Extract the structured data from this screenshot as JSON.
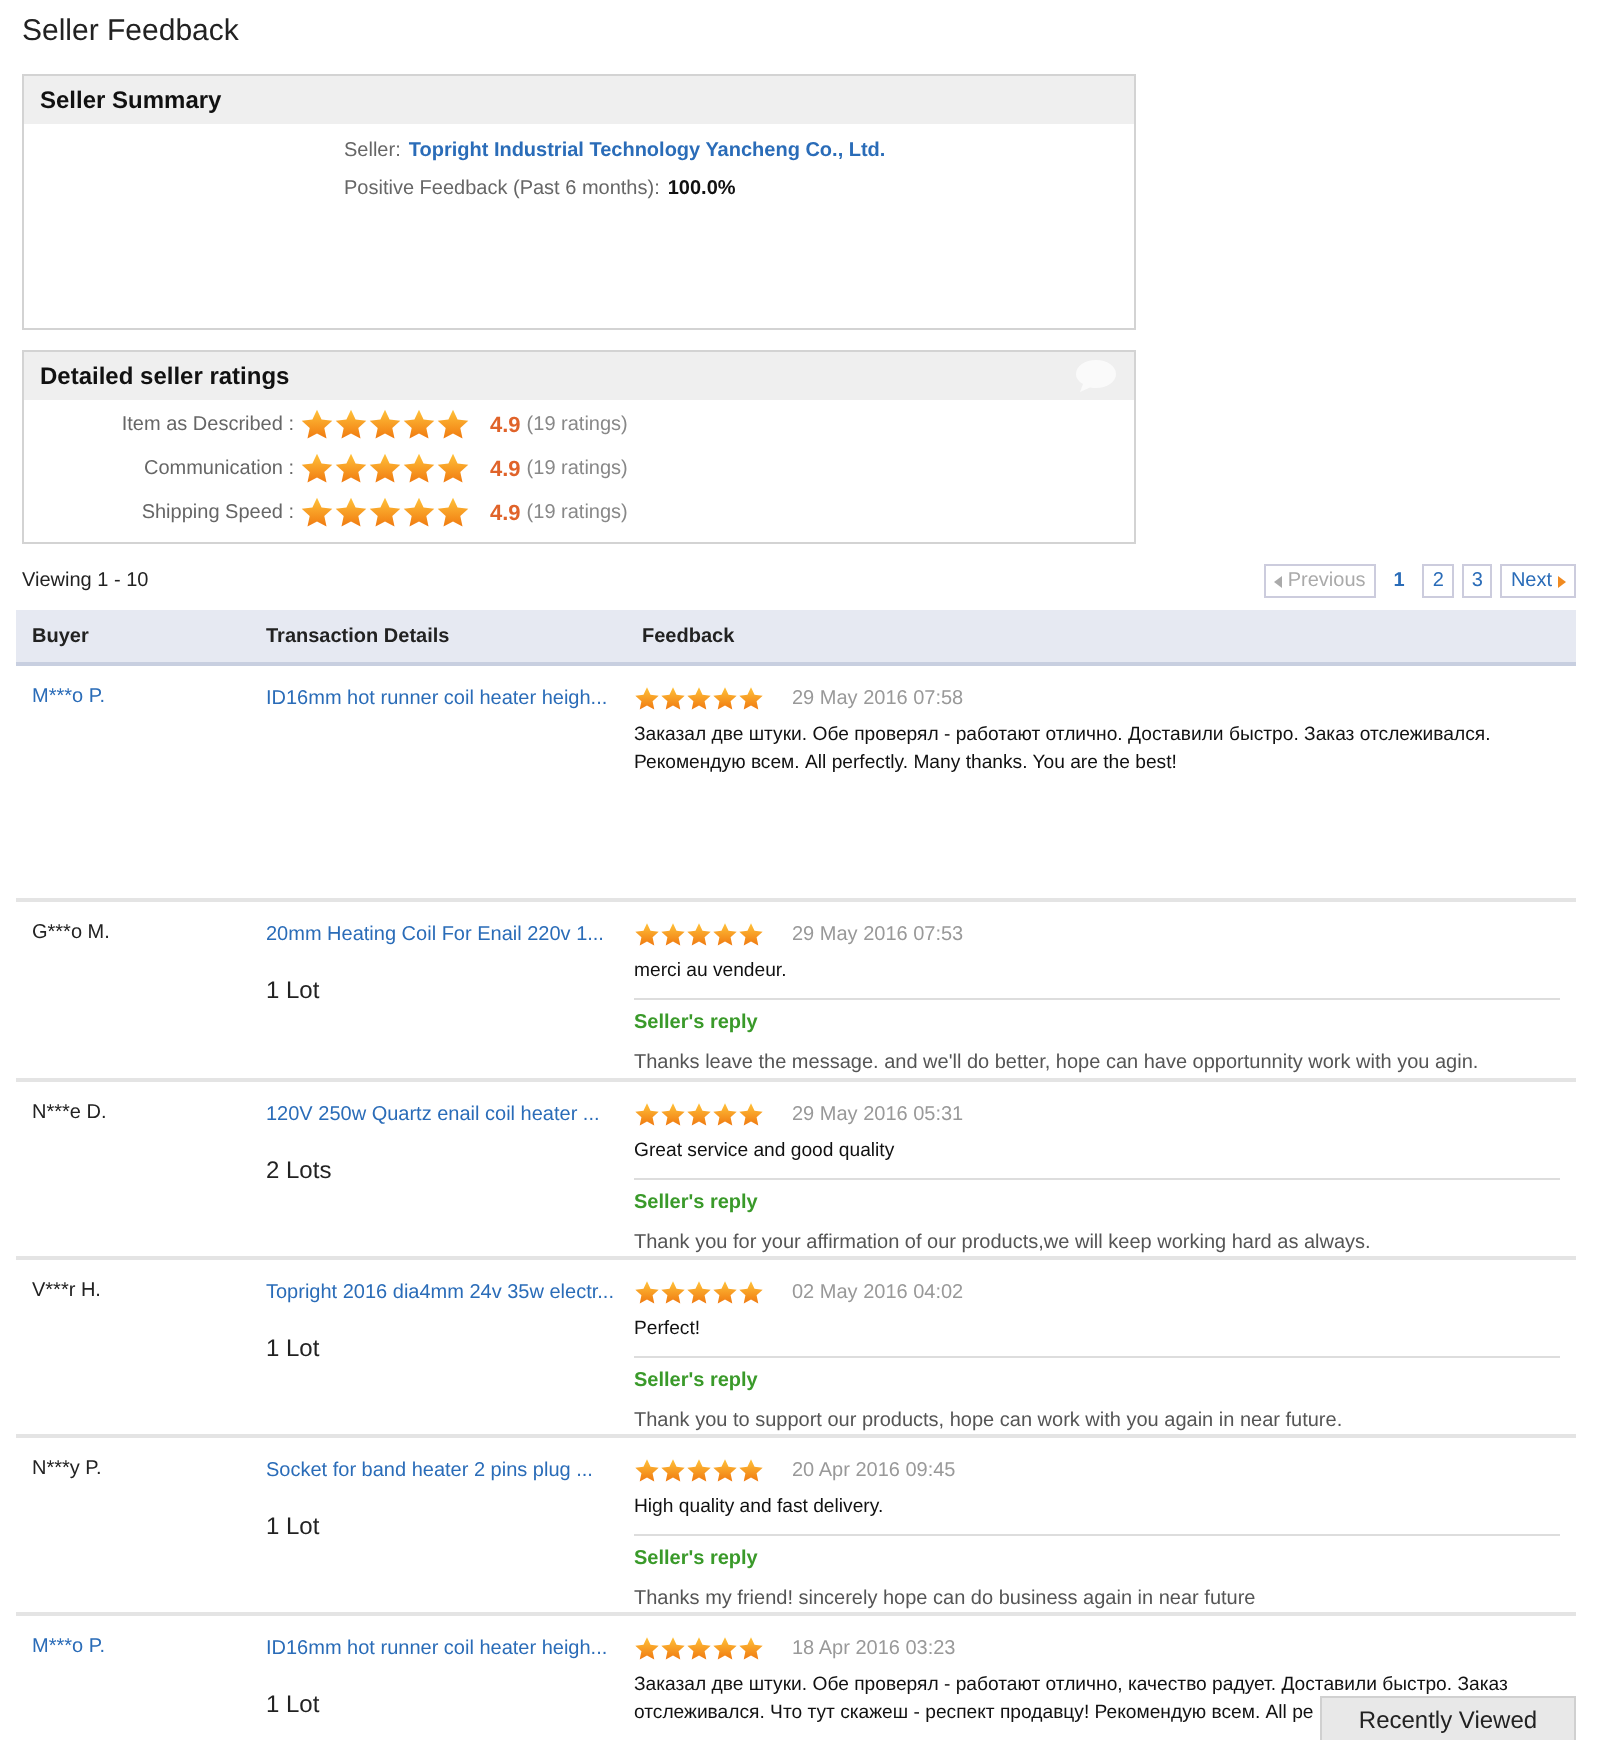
{
  "title": "Seller Feedback",
  "seller_summary": {
    "heading": "Seller Summary",
    "seller_label": "Seller:",
    "seller_name": "Topright Industrial Technology Yancheng Co., Ltd.",
    "positive_label": "Positive Feedback (Past 6 months):",
    "positive_value": "100.0%"
  },
  "detailed_ratings": {
    "heading": "Detailed seller ratings",
    "items": [
      {
        "label": "Item as Described :",
        "stars": 5,
        "score": "4.9",
        "count": "(19 ratings)"
      },
      {
        "label": "Communication :",
        "stars": 5,
        "score": "4.9",
        "count": "(19 ratings)"
      },
      {
        "label": "Shipping Speed :",
        "stars": 5,
        "score": "4.9",
        "count": "(19 ratings)"
      }
    ]
  },
  "viewing": "Viewing 1 - 10",
  "pagination": {
    "previous": {
      "label": "Previous",
      "disabled": true
    },
    "pages": [
      {
        "label": "1",
        "selected": true
      },
      {
        "label": "2",
        "selected": false
      },
      {
        "label": "3",
        "selected": false
      }
    ],
    "next": {
      "label": "Next",
      "disabled": false
    }
  },
  "table": {
    "columns": [
      "Buyer",
      "Transaction Details",
      "Feedback"
    ],
    "rows": [
      {
        "buyer": "M***o P.",
        "buyer_link": true,
        "product": "ID16mm hot runner coil heater heigh...",
        "stars": 5,
        "date": "29 May 2016 07:58",
        "text": "Заказал две штуки. Обе проверял - работают отлично. Доставили быстро. Заказ отслеживался. Рекомендую всем. All perfectly. Many thanks. You are the best!"
      },
      {
        "buyer": "G***o M.",
        "buyer_link": false,
        "product": "20mm Heating Coil For Enail 220v 1...",
        "quantity": "1 Lot",
        "stars": 5,
        "date": "29 May 2016 07:53",
        "text": "merci au vendeur.",
        "reply_label": "Seller's reply",
        "reply": "Thanks leave the message. and we'll do better, hope can have opportunnity work with you agin."
      },
      {
        "buyer": "N***e D.",
        "buyer_link": false,
        "product": "120V 250w Quartz enail coil heater ...",
        "quantity": "2 Lots",
        "stars": 5,
        "date": "29 May 2016 05:31",
        "text": "Great service and good quality",
        "reply_label": "Seller's reply",
        "reply": "Thank you for your affirmation of our products,we will keep working hard as always."
      },
      {
        "buyer": "V***r H.",
        "buyer_link": false,
        "product": "Topright 2016 dia4mm 24v 35w electr...",
        "quantity": "1 Lot",
        "stars": 5,
        "date": "02 May 2016 04:02",
        "text": "Perfect!",
        "reply_label": "Seller's reply",
        "reply": "Thank you to support our products, hope can work with you again in near future."
      },
      {
        "buyer": "N***y P.",
        "buyer_link": false,
        "product": "Socket for band heater 2 pins plug ...",
        "quantity": "1 Lot",
        "stars": 5,
        "date": "20 Apr 2016 09:45",
        "text": "High quality and fast delivery.",
        "reply_label": "Seller's reply",
        "reply": "Thanks my friend! sincerely hope can do business again in near future"
      },
      {
        "buyer": "M***o P.",
        "buyer_link": true,
        "product": "ID16mm hot runner coil heater heigh...",
        "quantity": "1 Lot",
        "stars": 5,
        "date": "18 Apr 2016 03:23",
        "text": "Заказал две штуки. Обе проверял - работают отлично, качество радует. Доставили быстро. Заказ",
        "text_line_2": "отслеживался. Что тут скажеш - респект продавцу! Рекомендую всем. All pe"
      }
    ]
  },
  "recently_viewed": "Recently Viewed"
}
